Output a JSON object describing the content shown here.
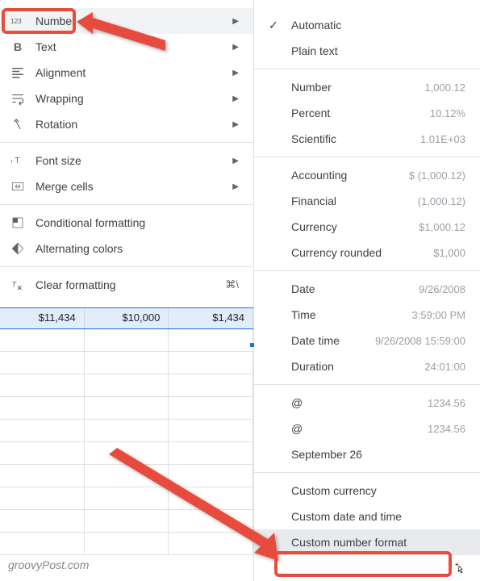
{
  "left_menu": {
    "number": "Number",
    "text": "Text",
    "alignment": "Alignment",
    "wrapping": "Wrapping",
    "rotation": "Rotation",
    "font_size": "Font size",
    "merge_cells": "Merge cells",
    "conditional_formatting": "Conditional formatting",
    "alternating_colors": "Alternating colors",
    "clear_formatting": "Clear formatting",
    "clear_shortcut": "⌘\\"
  },
  "right_menu": {
    "automatic": "Automatic",
    "plain_text": "Plain text",
    "number": {
      "label": "Number",
      "value": "1,000.12"
    },
    "percent": {
      "label": "Percent",
      "value": "10.12%"
    },
    "scientific": {
      "label": "Scientific",
      "value": "1.01E+03"
    },
    "accounting": {
      "label": "Accounting",
      "value": "$ (1,000.12)"
    },
    "financial": {
      "label": "Financial",
      "value": "(1,000.12)"
    },
    "currency": {
      "label": "Currency",
      "value": "$1,000.12"
    },
    "currency_rounded": {
      "label": "Currency rounded",
      "value": "$1,000"
    },
    "date": {
      "label": "Date",
      "value": "9/26/2008"
    },
    "time": {
      "label": "Time",
      "value": "3:59:00 PM"
    },
    "date_time": {
      "label": "Date time",
      "value": "9/26/2008 15:59:00"
    },
    "duration": {
      "label": "Duration",
      "value": "24:01:00"
    },
    "at1": {
      "label": "@",
      "value": "1234.56"
    },
    "at2": {
      "label": "@",
      "value": "1234.56"
    },
    "sept": "September 26",
    "custom_currency": "Custom currency",
    "custom_date_time": "Custom date and time",
    "custom_number_format": "Custom number format"
  },
  "cells": {
    "c1": "$11,434",
    "c2": "$10,000",
    "c3": "$1,434"
  },
  "watermark": "groovyPost.com"
}
